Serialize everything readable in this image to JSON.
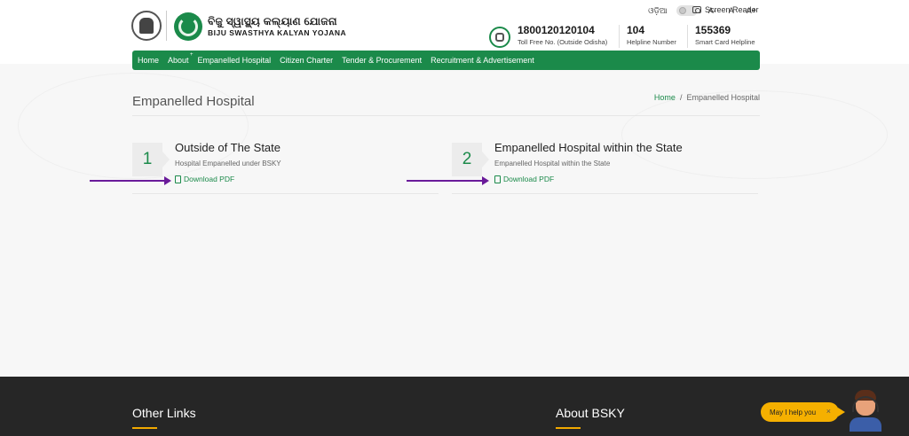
{
  "header": {
    "logo_title": "ବିଜୁ ସ୍ୱାସ୍ଥ୍ୟ କଲ୍ୟାଣ ଯୋଜନା",
    "logo_subtitle": "BIJU SWASTHYA KALYAN YOJANA",
    "language_label": "ଓଡ଼ିଆ",
    "font_decrease": "A-",
    "font_normal": "A",
    "font_increase": "A+",
    "screen_reader": "Screen Reader",
    "helplines": [
      {
        "number": "1800120120104",
        "label": "Toll Free No. (Outside Odisha)"
      },
      {
        "number": "104",
        "label": "Helpline Number"
      },
      {
        "number": "155369",
        "label": "Smart Card Helpline"
      }
    ]
  },
  "nav": {
    "items": [
      "Home",
      "About",
      "Empanelled Hospital",
      "Citizen Charter",
      "Tender & Procurement",
      "Recruitment & Advertisement"
    ]
  },
  "page": {
    "title": "Empanelled Hospital",
    "breadcrumb": {
      "home": "Home",
      "separator": "/",
      "current": "Empanelled Hospital"
    }
  },
  "cards": [
    {
      "number": "1",
      "title": "Outside of The State",
      "subtitle": "Hospital Empanelled under BSKY",
      "link": "Download PDF"
    },
    {
      "number": "2",
      "title": "Empanelled Hospital within the State",
      "subtitle": "Empanelled Hospital within the State",
      "link": "Download PDF"
    }
  ],
  "footer": {
    "left_title": "Other Links",
    "right_title": "About BSKY"
  },
  "chat": {
    "label": "May I help you",
    "close": "×"
  },
  "colors": {
    "brand_green": "#1b8a4a",
    "annotation_arrow": "#6a1b9a",
    "footer_bg": "#262626",
    "chat_yellow": "#f5b000"
  }
}
